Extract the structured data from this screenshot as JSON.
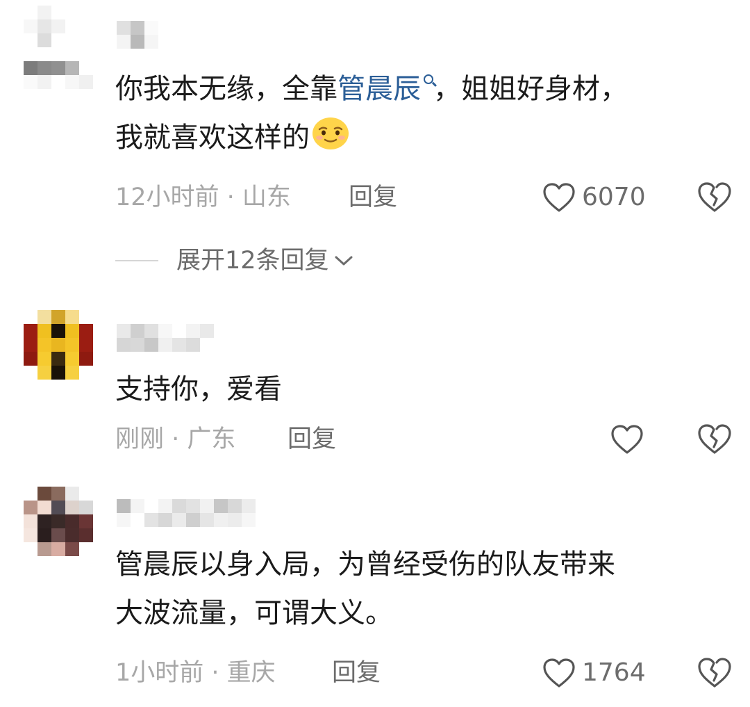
{
  "comments": [
    {
      "text_before_link": "你我本无缘，全靠",
      "link_text": "管晨辰",
      "text_after_link": "，姐姐好身材，",
      "text_line2": "我就喜欢这样的",
      "emoji": "smirk-emoji",
      "time_location": "12小时前 · 山东",
      "reply_label": "回复",
      "like_count": "6070"
    },
    {
      "text": "支持你，爱看",
      "time_location": "刚刚 · 广东",
      "reply_label": "回复",
      "like_count": ""
    },
    {
      "text_line1": "管晨辰以身入局，为曾经受伤的队友带来",
      "text_line2": "大波流量，可谓大义。",
      "time_location": "1小时前 · 重庆",
      "reply_label": "回复",
      "like_count": "1764"
    }
  ],
  "expand_replies": {
    "label": "展开12条回复"
  },
  "icons": {
    "like": "heart-outline-icon",
    "dislike": "broken-heart-icon",
    "expand": "chevron-down-icon",
    "search": "search-icon"
  },
  "colors": {
    "link": "#2b5e97",
    "text": "#1b1b1b",
    "meta": "#a7a7a7",
    "secondary": "#6c6c6c",
    "icon": "#555555"
  }
}
